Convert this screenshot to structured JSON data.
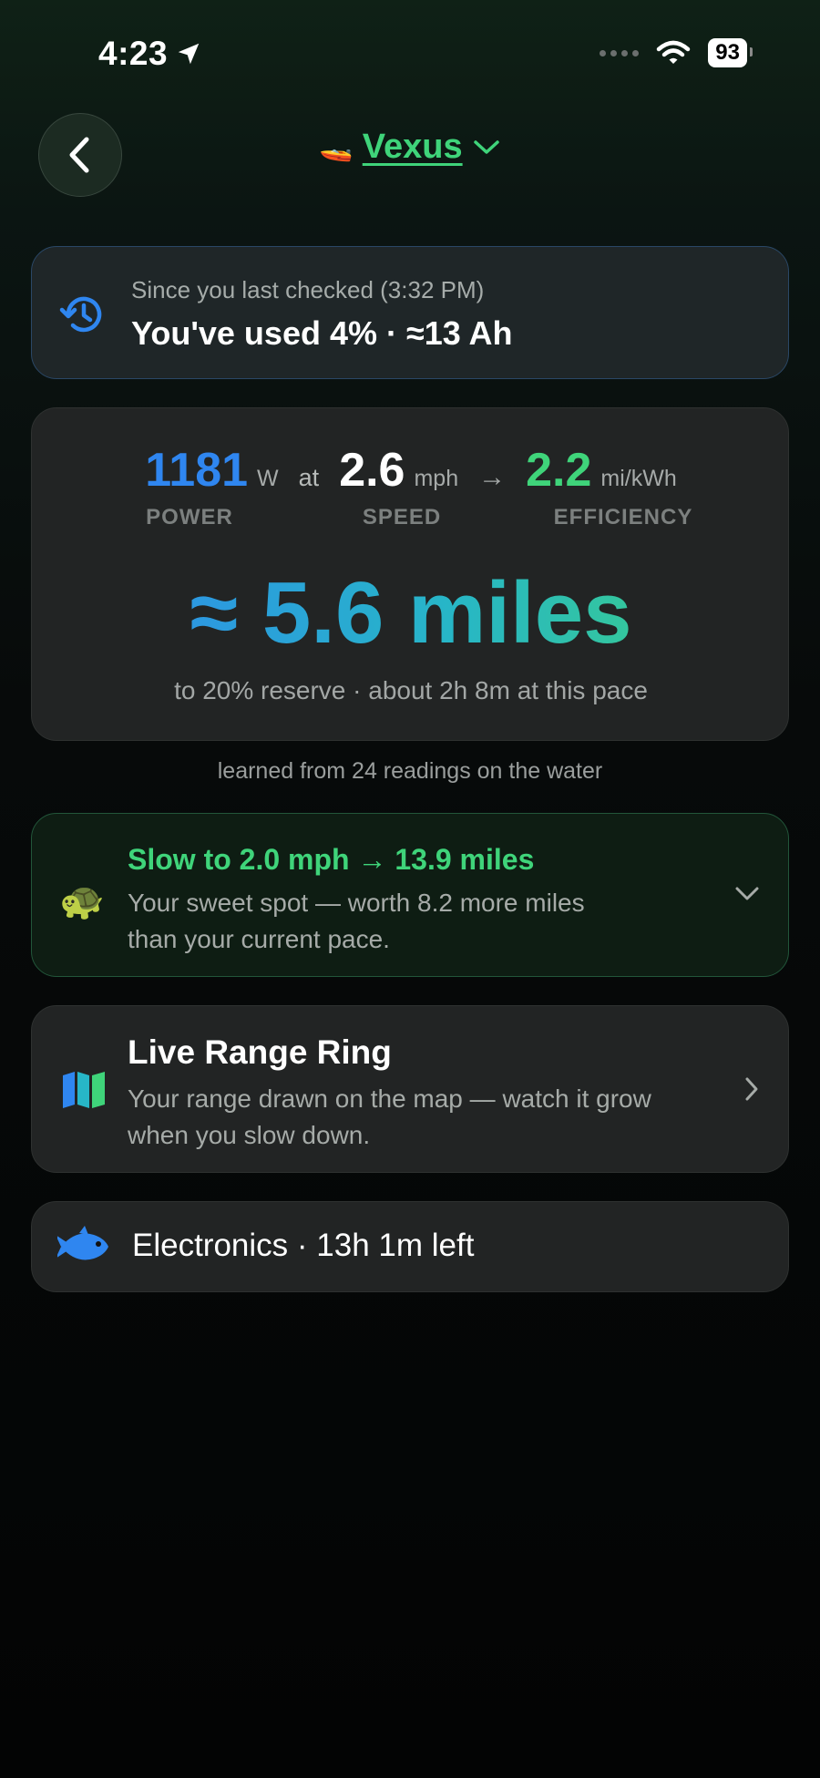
{
  "status_bar": {
    "time": "4:23",
    "battery": "93"
  },
  "header": {
    "boat_emoji": "🚤",
    "title": "Vexus"
  },
  "since_card": {
    "subtitle": "Since you last checked (3:32 PM)",
    "main": "You've used 4% · ≈13 Ah"
  },
  "stats": {
    "power_value": "1181",
    "power_unit": "W",
    "power_label": "POWER",
    "at_text": "at",
    "speed_value": "2.6",
    "speed_unit": "mph",
    "speed_label": "SPEED",
    "arrow": "→",
    "efficiency_value": "2.2",
    "efficiency_unit": "mi/kWh",
    "efficiency_label": "EFFICIENCY",
    "range": "≈ 5.6 miles",
    "reserve_text": "to 20% reserve · about 2h 8m at this pace"
  },
  "learned_text": "learned from 24 readings on the water",
  "slow_card": {
    "emoji": "🐢",
    "title": "Slow to 2.0 mph → 13.9 miles",
    "body": "Your sweet spot — worth 8.2 more miles than your current pace."
  },
  "live_card": {
    "title": "Live Range Ring",
    "body": "Your range drawn on the map — watch it grow when you slow down."
  },
  "electronics_card": {
    "label": "Electronics · 13h 1m left"
  },
  "colors": {
    "accent_green": "#3fd47a",
    "accent_blue": "#2f86f0"
  }
}
